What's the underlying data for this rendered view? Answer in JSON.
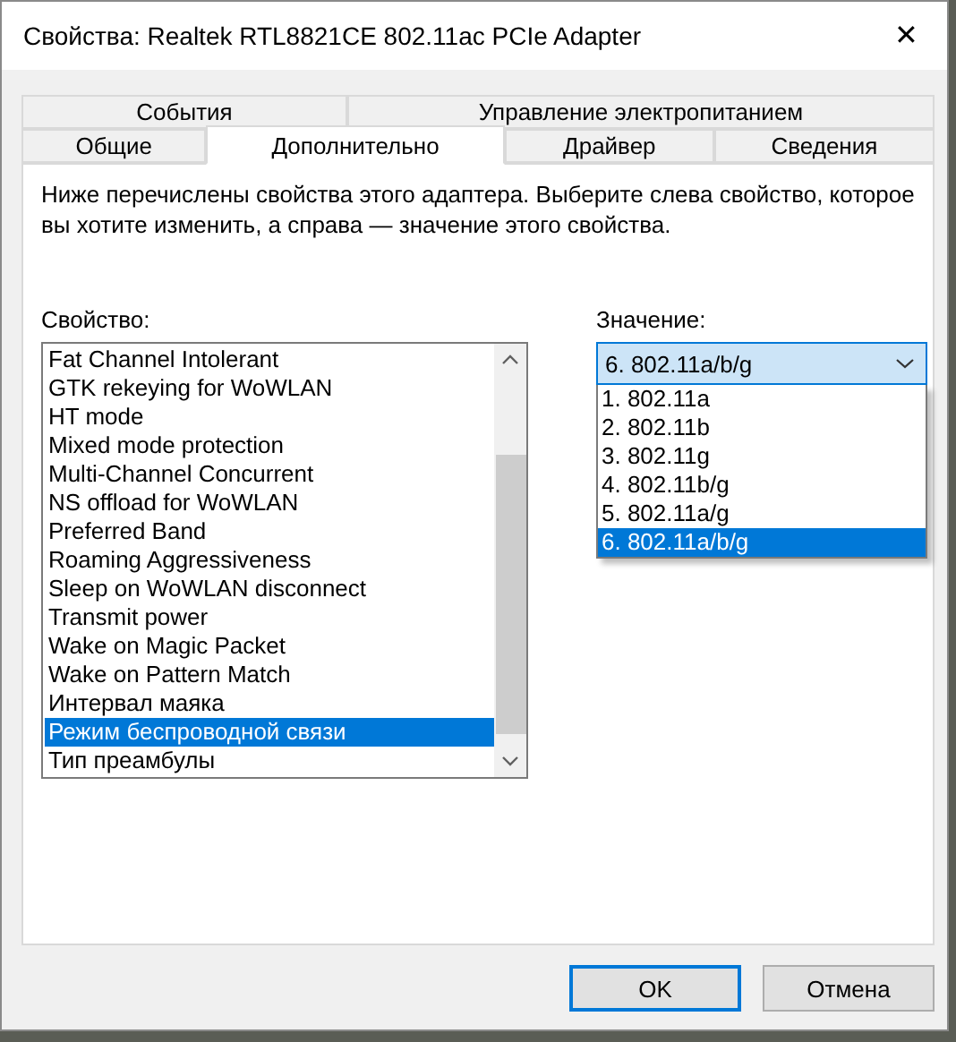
{
  "window": {
    "title": "Свойства: Realtek RTL8821CE 802.11ac PCIe Adapter",
    "close": "✕"
  },
  "tab_rows": [
    [
      {
        "label": "События",
        "selected": false
      },
      {
        "label": "Управление электропитанием",
        "selected": false
      }
    ],
    [
      {
        "label": "Общие",
        "selected": false
      },
      {
        "label": "Дополнительно",
        "selected": true
      },
      {
        "label": "Драйвер",
        "selected": false
      },
      {
        "label": "Сведения",
        "selected": false
      }
    ]
  ],
  "description": "Ниже перечислены свойства этого адаптера. Выберите слева свойство, которое вы хотите изменить, а справа — значение этого свойства.",
  "property": {
    "label": "Свойство:",
    "items": [
      {
        "label": "Fat Channel Intolerant",
        "selected": false
      },
      {
        "label": "GTK rekeying for WoWLAN",
        "selected": false
      },
      {
        "label": "HT mode",
        "selected": false
      },
      {
        "label": "Mixed mode protection",
        "selected": false
      },
      {
        "label": "Multi-Channel Concurrent",
        "selected": false
      },
      {
        "label": "NS offload for WoWLAN",
        "selected": false
      },
      {
        "label": "Preferred Band",
        "selected": false
      },
      {
        "label": "Roaming Aggressiveness",
        "selected": false
      },
      {
        "label": "Sleep on WoWLAN disconnect",
        "selected": false
      },
      {
        "label": "Transmit power",
        "selected": false
      },
      {
        "label": "Wake on Magic Packet",
        "selected": false
      },
      {
        "label": "Wake on Pattern Match",
        "selected": false
      },
      {
        "label": "Интервал маяка",
        "selected": false
      },
      {
        "label": "Режим беспроводной связи",
        "selected": true
      },
      {
        "label": "Тип преамбулы",
        "selected": false
      }
    ]
  },
  "value": {
    "label": "Значение:",
    "current": "6. 802.11a/b/g",
    "expanded": true,
    "options": [
      {
        "label": "1. 802.11a",
        "selected": false
      },
      {
        "label": "2. 802.11b",
        "selected": false
      },
      {
        "label": "3. 802.11g",
        "selected": false
      },
      {
        "label": "4. 802.11b/g",
        "selected": false
      },
      {
        "label": "5. 802.11a/g",
        "selected": false
      },
      {
        "label": "6. 802.11a/b/g",
        "selected": true
      }
    ]
  },
  "buttons": [
    {
      "label": "OK",
      "default": true
    },
    {
      "label": "Отмена",
      "default": false
    }
  ]
}
